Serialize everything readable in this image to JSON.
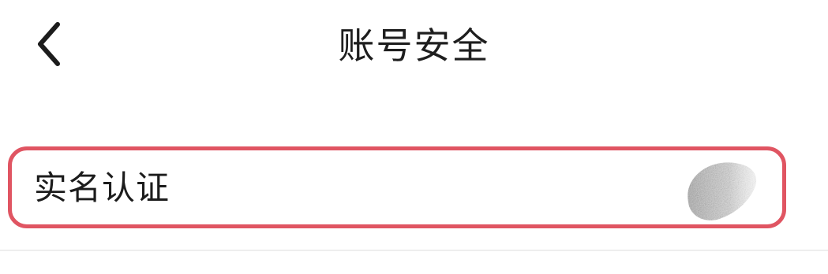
{
  "header": {
    "title": "账号安全",
    "back_icon": "chevron-left-icon"
  },
  "rows": [
    {
      "label": "实名认证",
      "value_state": "redacted",
      "highlight_color": "#e05562"
    }
  ],
  "colors": {
    "background": "#ffffff",
    "text": "#1c1c1c",
    "highlight": "#e05562",
    "divider": "#eeeeee"
  }
}
